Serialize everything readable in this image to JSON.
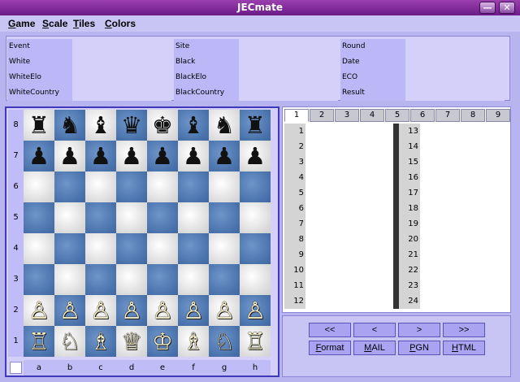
{
  "window": {
    "title": "JECmate",
    "minimize_glyph": "—",
    "close_glyph": "✕"
  },
  "menu": [
    "Game",
    "Scale",
    "Tiles",
    "Colors"
  ],
  "info_fields": [
    [
      "Event",
      "Site",
      "Round"
    ],
    [
      "White",
      "Black",
      "Date"
    ],
    [
      "WhiteElo",
      "BlackElo",
      "ECO"
    ],
    [
      "WhiteCountry",
      "BlackCountry",
      "Result"
    ]
  ],
  "board": {
    "ranks": [
      "8",
      "7",
      "6",
      "5",
      "4",
      "3",
      "2",
      "1"
    ],
    "files": [
      "a",
      "b",
      "c",
      "d",
      "e",
      "f",
      "g",
      "h"
    ],
    "rows": [
      [
        "♜",
        "♞",
        "♝",
        "♛",
        "♚",
        "♝",
        "♞",
        "♜"
      ],
      [
        "♟",
        "♟",
        "♟",
        "♟",
        "♟",
        "♟",
        "♟",
        "♟"
      ],
      [
        "",
        "",
        "",
        "",
        "",
        "",
        "",
        ""
      ],
      [
        "",
        "",
        "",
        "",
        "",
        "",
        "",
        ""
      ],
      [
        "",
        "",
        "",
        "",
        "",
        "",
        "",
        ""
      ],
      [
        "",
        "",
        "",
        "",
        "",
        "",
        "",
        ""
      ],
      [
        "♙",
        "♙",
        "♙",
        "♙",
        "♙",
        "♙",
        "♙",
        "♙"
      ],
      [
        "♖",
        "♘",
        "♗",
        "♕",
        "♔",
        "♗",
        "♘",
        "♖"
      ]
    ]
  },
  "move_tabs": [
    "1",
    "2",
    "3",
    "4",
    "5",
    "6",
    "7",
    "8",
    "9"
  ],
  "active_tab": 0,
  "move_numbers_left": [
    "1",
    "2",
    "3",
    "4",
    "5",
    "6",
    "7",
    "8",
    "9",
    "10",
    "11",
    "12"
  ],
  "move_numbers_right": [
    "13",
    "14",
    "15",
    "16",
    "17",
    "18",
    "19",
    "20",
    "21",
    "22",
    "23",
    "24"
  ],
  "nav_buttons": [
    "<<",
    "<",
    ">",
    ">>"
  ],
  "action_buttons": [
    "Format",
    "MAIL",
    "PGN",
    "HTML"
  ]
}
